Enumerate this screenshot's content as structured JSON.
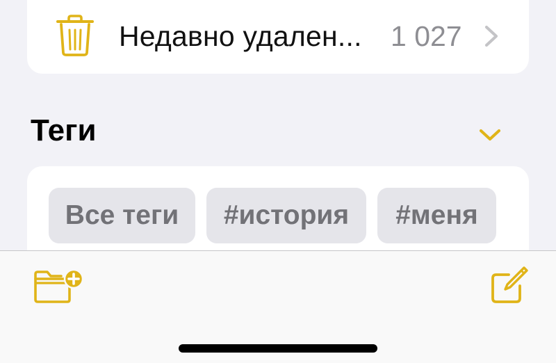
{
  "deleted_row": {
    "label": "Недавно удален...",
    "count": "1 027",
    "icon": "trash-icon"
  },
  "tags_section": {
    "title": "Теги",
    "toggle_icon": "chevron-down-icon",
    "chips": [
      {
        "label": "Все теги"
      },
      {
        "label": "#история"
      },
      {
        "label": "#меня"
      }
    ]
  },
  "toolbar": {
    "new_folder_icon": "folder-plus-icon",
    "compose_icon": "compose-icon"
  },
  "colors": {
    "accent": "#e0b418",
    "background": "#f2f2f7",
    "card": "#ffffff",
    "chip": "#e5e5ea",
    "chip_text": "#727277",
    "secondary_text": "#8e8e93",
    "chevron": "#c4c4c7"
  }
}
